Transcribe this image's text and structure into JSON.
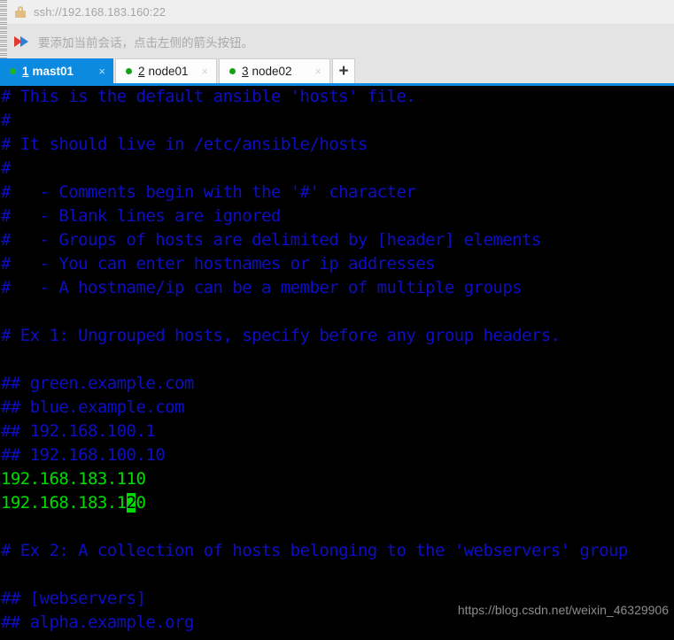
{
  "address_bar": {
    "icon": "lock-icon",
    "url": "ssh://192.168.183.160:22"
  },
  "hint_bar": {
    "icon": "arrow-right-icon",
    "message": "要添加当前会话，点击左侧的箭头按钮。"
  },
  "tabs": {
    "new_tab_label": "+",
    "close_label": "×",
    "items": [
      {
        "index": "1",
        "name": "mast01",
        "active": true
      },
      {
        "index": "2",
        "name": "node01",
        "active": false
      },
      {
        "index": "3",
        "name": "node02",
        "active": false
      }
    ]
  },
  "terminal": {
    "colors": {
      "background": "#000000",
      "comment": "#0e0ec4",
      "value": "#00dd00",
      "cursor": "#00dd00"
    },
    "cursor": {
      "line": 17,
      "column": 13,
      "char": "2"
    },
    "lines": [
      {
        "text": "# This is the default ansible 'hosts' file.",
        "color": "comment"
      },
      {
        "text": "#",
        "color": "comment"
      },
      {
        "text": "# It should live in /etc/ansible/hosts",
        "color": "comment"
      },
      {
        "text": "#",
        "color": "comment"
      },
      {
        "text": "#   - Comments begin with the '#' character",
        "color": "comment"
      },
      {
        "text": "#   - Blank lines are ignored",
        "color": "comment"
      },
      {
        "text": "#   - Groups of hosts are delimited by [header] elements",
        "color": "comment"
      },
      {
        "text": "#   - You can enter hostnames or ip addresses",
        "color": "comment"
      },
      {
        "text": "#   - A hostname/ip can be a member of multiple groups",
        "color": "comment"
      },
      {
        "text": "",
        "color": "comment"
      },
      {
        "text": "# Ex 1: Ungrouped hosts, specify before any group headers.",
        "color": "comment"
      },
      {
        "text": "",
        "color": "comment"
      },
      {
        "text": "## green.example.com",
        "color": "comment"
      },
      {
        "text": "## blue.example.com",
        "color": "comment"
      },
      {
        "text": "## 192.168.100.1",
        "color": "comment"
      },
      {
        "text": "## 192.168.100.10",
        "color": "comment"
      },
      {
        "text": "192.168.183.110",
        "color": "value"
      },
      {
        "text": "192.168.183.120",
        "color": "value"
      },
      {
        "text": "",
        "color": "comment"
      },
      {
        "text": "# Ex 2: A collection of hosts belonging to the 'webservers' group",
        "color": "comment"
      },
      {
        "text": "",
        "color": "comment"
      },
      {
        "text": "## [webservers]",
        "color": "comment"
      },
      {
        "text": "## alpha.example.org",
        "color": "comment"
      }
    ]
  },
  "watermark": {
    "text": "https://blog.csdn.net/weixin_46329906"
  }
}
